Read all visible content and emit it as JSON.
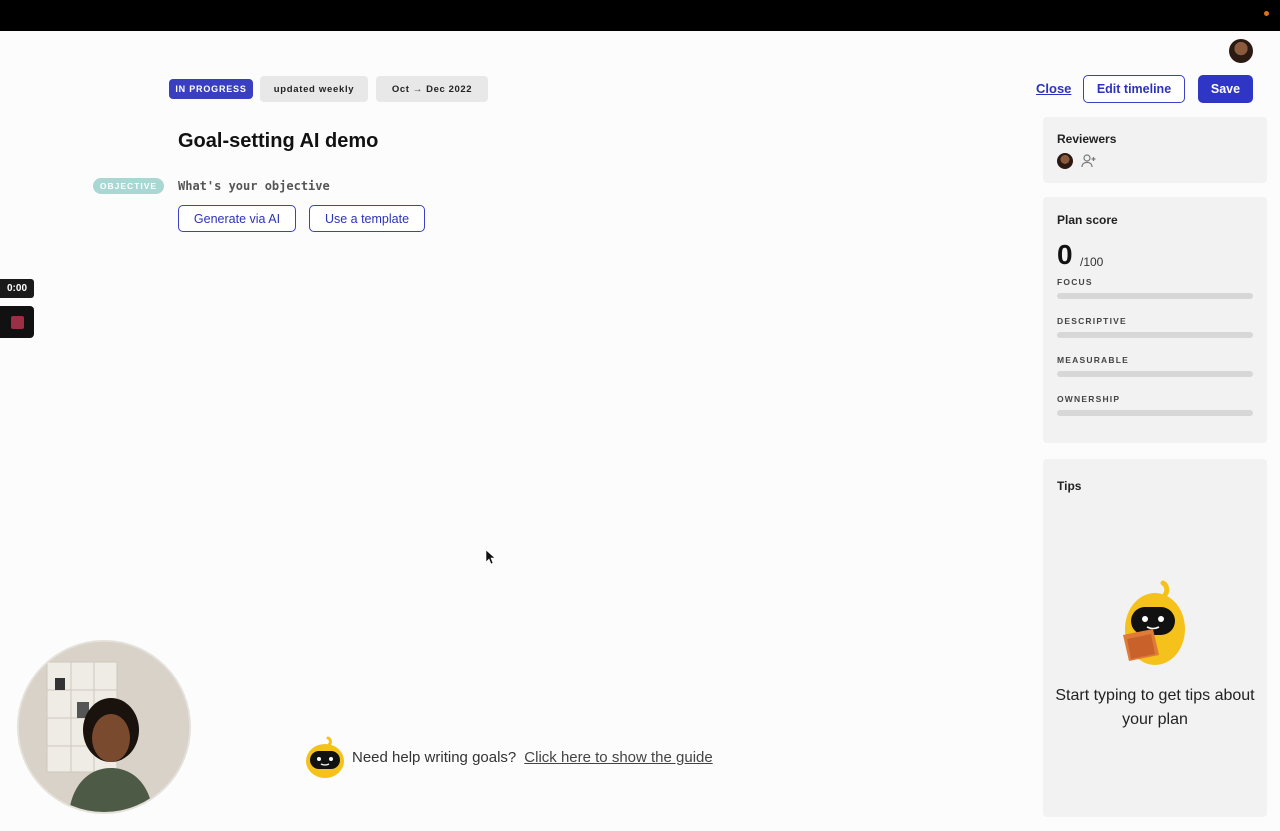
{
  "header": {
    "status": "IN PROGRESS",
    "frequency": "updated weekly",
    "date_range": "Oct → Dec 2022",
    "close_label": "Close",
    "edit_timeline_label": "Edit timeline",
    "save_label": "Save"
  },
  "recording": {
    "timer": "0:00"
  },
  "goal": {
    "title": "Goal-setting AI demo",
    "objective_badge": "OBJECTIVE",
    "objective_placeholder": "What's your objective",
    "generate_ai_label": "Generate via AI",
    "template_label": "Use a template"
  },
  "sidebar": {
    "reviewers_heading": "Reviewers",
    "plan_score": {
      "heading": "Plan score",
      "score": "0",
      "max": "/100",
      "metrics": [
        {
          "label": "FOCUS",
          "value": 0
        },
        {
          "label": "DESCRIPTIVE",
          "value": 0
        },
        {
          "label": "MEASURABLE",
          "value": 0
        },
        {
          "label": "OWNERSHIP",
          "value": 0
        }
      ]
    },
    "tips": {
      "heading": "Tips",
      "empty_message": "Start typing to get tips about your plan"
    }
  },
  "helper": {
    "question": "Need help writing goals?",
    "link": "Click here to show the guide"
  },
  "icons": {
    "add_reviewer": "add-person-icon",
    "stop": "stop-icon",
    "mascot": "mascot-icon"
  },
  "colors": {
    "accent": "#2f35c4",
    "objective_badge": "#a9d7d3",
    "mascot": "#f5c21b"
  }
}
